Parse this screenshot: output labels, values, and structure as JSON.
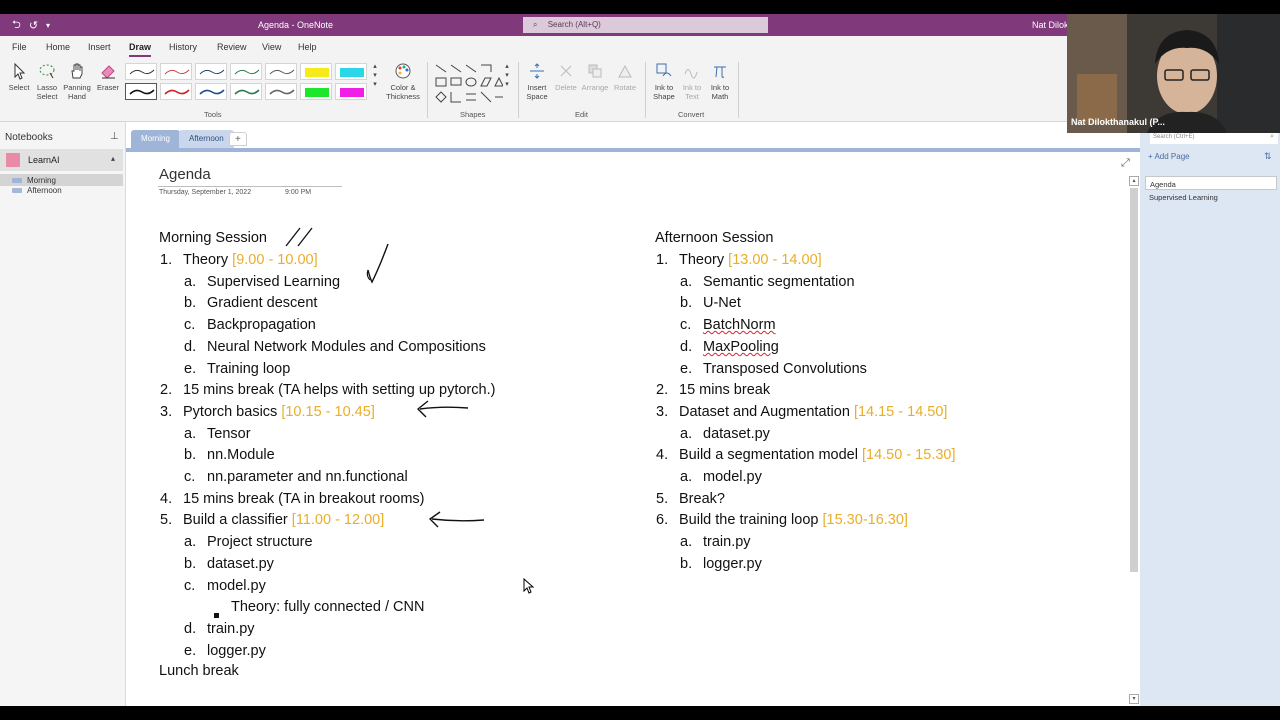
{
  "titlebar": {
    "title": "Agenda  -  OneNote",
    "search_placeholder": "Search (Alt+Q)",
    "user": "Nat Dilokt"
  },
  "menu": {
    "tabs": [
      "File",
      "Home",
      "Insert",
      "Draw",
      "History",
      "Review",
      "View",
      "Help"
    ],
    "active": "Draw"
  },
  "ribbon": {
    "select": "Select",
    "lasso_select": "Lasso Select",
    "panning_hand": "Panning Hand",
    "eraser": "Eraser",
    "color_thickness": "Color & Thickness",
    "tools_group": "Tools",
    "shapes_group": "Shapes",
    "insert_space": "Insert Space",
    "delete": "Delete",
    "arrange": "Arrange",
    "rotate": "Rotate",
    "edit_group": "Edit",
    "ink_to_shape": "Ink to Shape",
    "ink_to_text": "Ink to Text",
    "ink_to_math": "Ink to Math",
    "convert_group": "Convert"
  },
  "notebooks": {
    "header": "Notebooks",
    "notebook_name": "LearnAI",
    "sections": [
      {
        "label": "Morning",
        "color": "#9fb5d8"
      },
      {
        "label": "Afternoon",
        "color": "#a6b7dc"
      }
    ]
  },
  "section_tabs": {
    "morning": "Morning",
    "afternoon": "Afternoon",
    "add": "+"
  },
  "page": {
    "title": "Agenda",
    "date": "Thursday, September 1, 2022",
    "time": "9:00 PM",
    "morning": {
      "heading": "Morning Session",
      "items": [
        {
          "num": "1.",
          "text": "Theory ",
          "time": "[9.00 - 10.00]"
        },
        {
          "num": "a.",
          "text": "Supervised Learning"
        },
        {
          "num": "b.",
          "text": "Gradient descent"
        },
        {
          "num": "c.",
          "text": "Backpropagation"
        },
        {
          "num": "d.",
          "text": "Neural Network Modules and Compositions"
        },
        {
          "num": "e.",
          "text": "Training loop"
        },
        {
          "num": "2.",
          "text": "15 mins break (TA helps with setting up pytorch.)"
        },
        {
          "num": "3.",
          "text": "Pytorch basics ",
          "time": "[10.15 - 10.45]"
        },
        {
          "num": "a.",
          "text": "Tensor"
        },
        {
          "num": "b.",
          "text": "nn.Module"
        },
        {
          "num": "c.",
          "text": "nn.parameter and nn.functional"
        },
        {
          "num": "4.",
          "text": "15 mins break (TA in breakout rooms)"
        },
        {
          "num": "5.",
          "text": "Build a classifier ",
          "time": "[11.00 - 12.00]"
        },
        {
          "num": "a.",
          "text": "Project structure"
        },
        {
          "num": "b.",
          "text": "dataset.py"
        },
        {
          "num": "c.",
          "text": "model.py"
        },
        {
          "num": "",
          "text": "Theory: fully connected / CNN"
        },
        {
          "num": "d.",
          "text": "train.py"
        },
        {
          "num": "e.",
          "text": "logger.py"
        }
      ],
      "footer": "Lunch break"
    },
    "afternoon": {
      "heading": "Afternoon Session",
      "items": [
        {
          "num": "1.",
          "text": "Theory ",
          "time": "[13.00 - 14.00]"
        },
        {
          "num": "a.",
          "text": "Semantic segmentation"
        },
        {
          "num": "b.",
          "text": "U-Net"
        },
        {
          "num": "c.",
          "text": "BatchNorm"
        },
        {
          "num": "d.",
          "text": "MaxPooling"
        },
        {
          "num": "e.",
          "text": "Transposed Convolutions"
        },
        {
          "num": "2.",
          "text": "15 mins break"
        },
        {
          "num": "3.",
          "text": "Dataset and Augmentation ",
          "time": "[14.15 - 14.50]"
        },
        {
          "num": "a.",
          "text": "dataset.py"
        },
        {
          "num": "4.",
          "text": "Build a segmentation model ",
          "time": "[14.50 - 15.30]"
        },
        {
          "num": "a.",
          "text": "model.py"
        },
        {
          "num": "5.",
          "text": "Break?"
        },
        {
          "num": "6.",
          "text": "Build the training loop ",
          "time": "[15.30-16.30]"
        },
        {
          "num": "a.",
          "text": "train.py"
        },
        {
          "num": "b.",
          "text": "logger.py"
        }
      ]
    }
  },
  "pages_panel": {
    "search_placeholder": "Search (Ctrl+E)",
    "add_page": "Add Page",
    "pages": [
      "Agenda",
      "Supervised Learning"
    ],
    "active": "Agenda"
  },
  "webcam": {
    "name": "Nat Dilokthanakul (P..."
  },
  "colors": {
    "accent": "#80397b",
    "time_highlight": "#e8ae2a",
    "section_tab": "#9fb5d8"
  }
}
